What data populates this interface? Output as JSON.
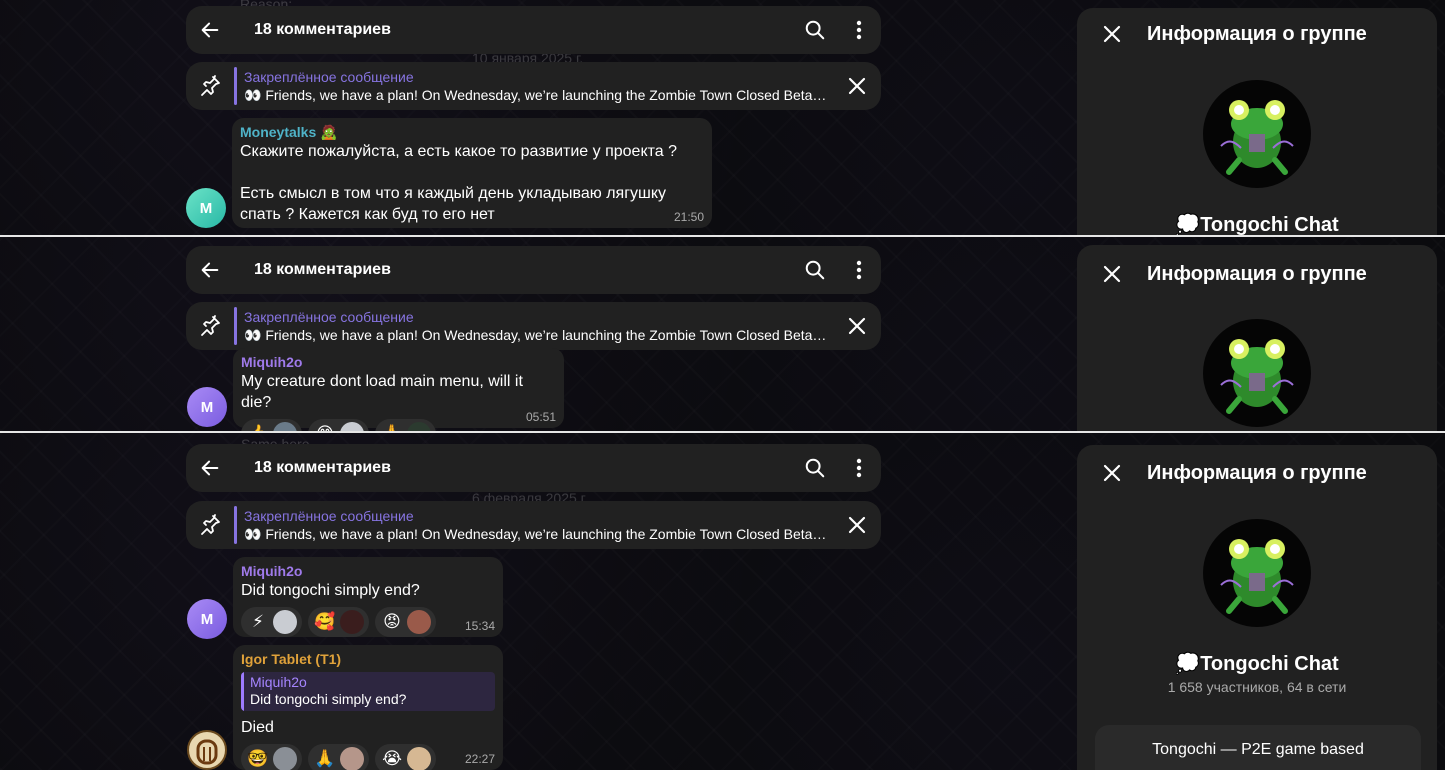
{
  "header": {
    "title": "18 комментариев"
  },
  "pinned": {
    "title": "Закреплённое сообщение",
    "text": "👀 Friends, we have a plan! On Wednesday, we’re launching the Zombie Town Closed Beta T…"
  },
  "info_panel": {
    "title": "Информация о группе",
    "group_name": "💭Tongochi Chat",
    "members": "1 658 участников, 64 в сети",
    "description": "Tongochi — P2E game based"
  },
  "strip1": {
    "ghost_top": "Reason:",
    "ghost_date": "10 января 2025 г.",
    "message": {
      "author": "Moneytalks 🧟",
      "avatar_letter": "M",
      "text": "Скажите пожалуйста, а есть какое то развитие у проекта ?\n\nЕсть смысл в том что я каждый день укладываю лягушку спать ? Кажется как буд то его нет",
      "time": "21:50"
    }
  },
  "strip2": {
    "message": {
      "author": "Miquih2o",
      "avatar_letter": "M",
      "text": "My creature dont load main menu, will it die?",
      "time": "05:51",
      "reactions": [
        "👍",
        "😁",
        "🙏"
      ]
    }
  },
  "strip3": {
    "ghost_top": "Same here",
    "ghost_date": "6 февраля 2025 г.",
    "message1": {
      "author": "Miquih2o",
      "avatar_letter": "M",
      "text": "Did tongochi simply end?",
      "time": "15:34",
      "reactions": [
        "⚡",
        "🥰",
        "😡"
      ]
    },
    "message2": {
      "author": "Igor Tablet (T1)",
      "reply_name": "Miquih2o",
      "reply_text": "Did tongochi simply end?",
      "text": "Died",
      "time": "22:27",
      "reactions": [
        "🤓",
        "🙏",
        "😭"
      ]
    }
  },
  "colors": {
    "accent": "#8774e1",
    "bubble": "#212121",
    "moneytalks_name": "#4fb3c8",
    "miquih_name": "#9f7aea",
    "igor_name": "#e0a23a"
  },
  "icons": [
    "back-arrow-icon",
    "search-icon",
    "more-vertical-icon",
    "pin-icon",
    "close-icon"
  ]
}
